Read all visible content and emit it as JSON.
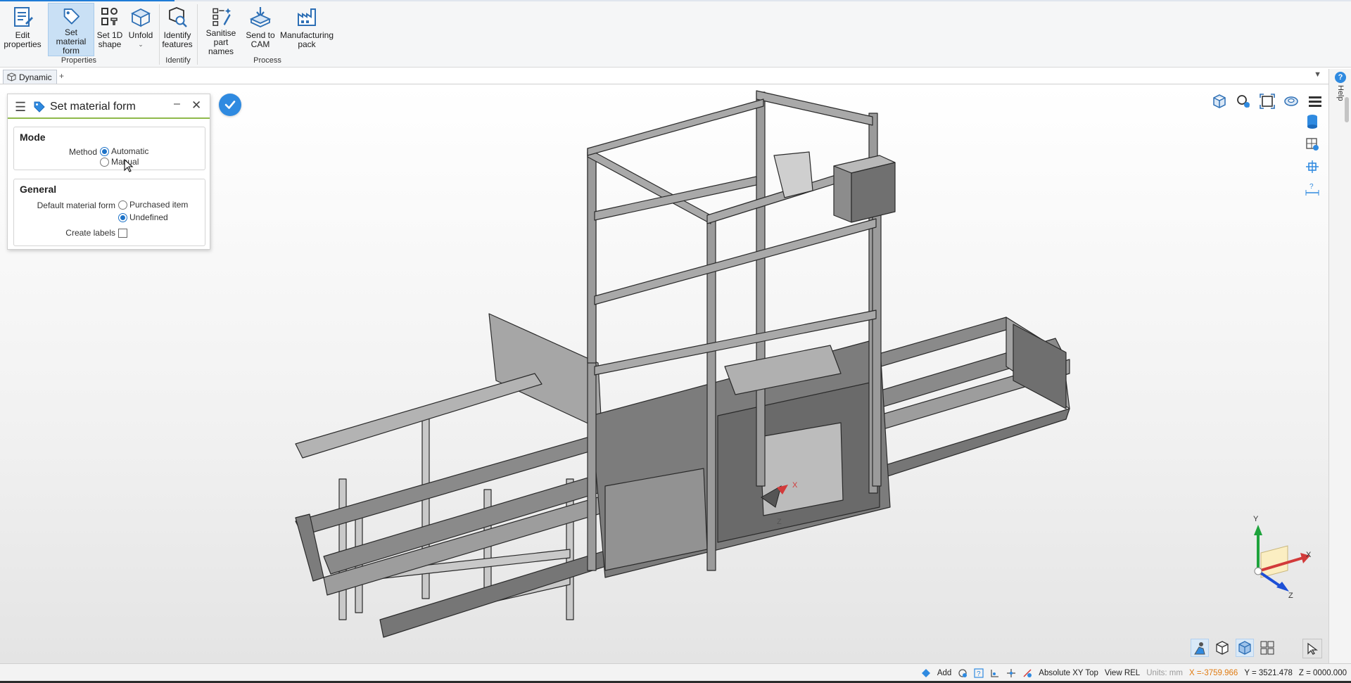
{
  "ribbon": {
    "buttons": {
      "edit_properties": "Edit\nproperties",
      "set_material_form": "Set material\nform",
      "set_1d_shape": "Set 1D\nshape",
      "unfold": "Unfold",
      "identify_features": "Identify\nfeatures",
      "sanitise_part_names": "Sanitise\npart names",
      "send_to_cam": "Send to\nCAM",
      "manufacturing_pack": "Manufacturing\npack"
    },
    "groups": {
      "properties": "Properties",
      "identify": "Identify",
      "process": "Process"
    }
  },
  "tabs": {
    "active": "Dynamic",
    "add": "+"
  },
  "help": {
    "label": "Help",
    "glyph": "?"
  },
  "panel": {
    "title": "Set material form",
    "mode": {
      "heading": "Mode",
      "method_label": "Method",
      "options": [
        "Automatic",
        "Manual"
      ],
      "selected": "Automatic"
    },
    "general": {
      "heading": "General",
      "default_form_label": "Default material form",
      "options": [
        "Purchased item",
        "Undefined"
      ],
      "selected": "Undefined",
      "create_labels_label": "Create labels",
      "create_labels_checked": false
    }
  },
  "triad": {
    "x": "X",
    "y": "Y",
    "z": "Z"
  },
  "model_triad": {
    "x": "X",
    "z": "Z"
  },
  "statusbar": {
    "add": "Add",
    "coord_system": "Absolute XY Top",
    "view": "View REL",
    "units": "Units: mm",
    "x": "X =-3759.966",
    "y": "Y = 3521.478",
    "z": "Z = 0000.000"
  },
  "colors": {
    "accent": "#2f8ae0",
    "panel_rule": "#8fb94b",
    "x_coord": "#e07b12",
    "model_fill": "#8f8f8f"
  }
}
